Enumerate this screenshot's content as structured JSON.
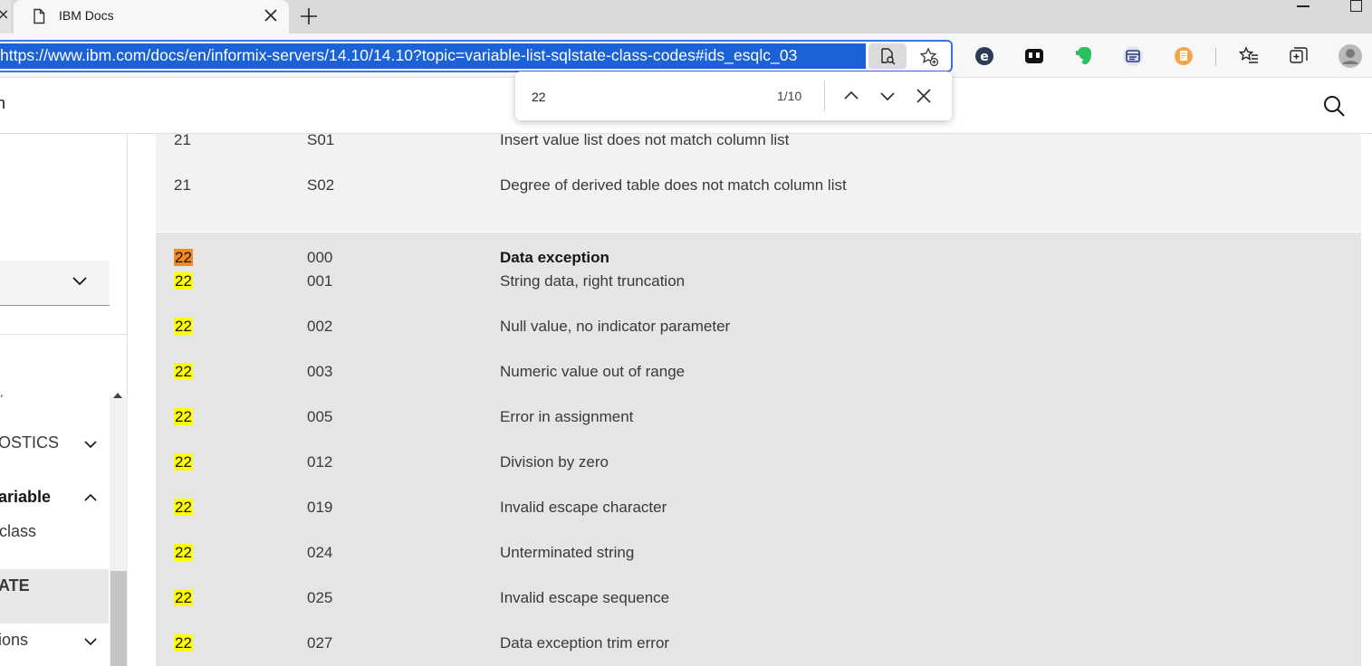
{
  "browser": {
    "tab": {
      "title": "IBM Docs"
    },
    "address_bar": {
      "url": "https://www.ibm.com/docs/en/informix-servers/14.10/14.10?topic=variable-list-sqlstate-class-codes#ids_esqlc_03"
    },
    "find_bar": {
      "query": "22",
      "count": "1/10"
    }
  },
  "header": {
    "title_fragment": "n"
  },
  "sidebar": {
    "items": [
      {
        "label": "OSTICS",
        "expanded": false
      },
      {
        "label": "ariable",
        "expanded": true
      },
      {
        "label": "class"
      },
      {
        "label": "ATE",
        "active": true
      },
      {
        "label": "ions",
        "expanded": false
      }
    ]
  },
  "table": {
    "rows_a": [
      {
        "class": "21",
        "subclass": "S01",
        "meaning": "Insert value list does not match column list"
      },
      {
        "class": "21",
        "subclass": "S02",
        "meaning": "Degree of derived table does not match column list"
      }
    ],
    "rows_b": [
      {
        "class": "22",
        "subclass": "000",
        "meaning": "Data exception",
        "bold": true,
        "current": true
      },
      {
        "class": "22",
        "subclass": "001",
        "meaning": "String data, right truncation"
      },
      {
        "class": "22",
        "subclass": "002",
        "meaning": "Null value, no indicator parameter"
      },
      {
        "class": "22",
        "subclass": "003",
        "meaning": "Numeric value out of range"
      },
      {
        "class": "22",
        "subclass": "005",
        "meaning": "Error in assignment"
      },
      {
        "class": "22",
        "subclass": "012",
        "meaning": "Division by zero"
      },
      {
        "class": "22",
        "subclass": "019",
        "meaning": "Invalid escape character"
      },
      {
        "class": "22",
        "subclass": "024",
        "meaning": "Unterminated string"
      },
      {
        "class": "22",
        "subclass": "025",
        "meaning": "Invalid escape sequence"
      },
      {
        "class": "22",
        "subclass": "027",
        "meaning": "Data exception trim error"
      }
    ]
  },
  "colors": {
    "highlight": "#ffff00",
    "current_match": "#f08a24",
    "url_selection": "#1a62d6"
  }
}
